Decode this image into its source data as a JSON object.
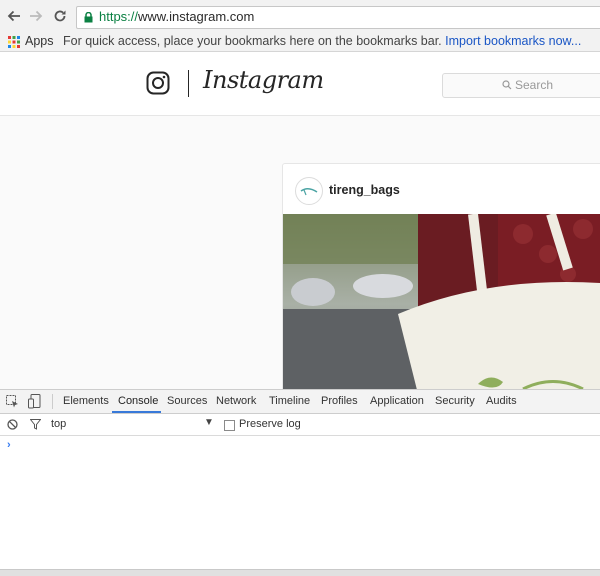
{
  "browser": {
    "url_scheme": "https://",
    "url_host": "www.instagram.com",
    "bookmarks_bar": {
      "apps_label": "Apps",
      "hint": "For quick access, place your bookmarks here on the bookmarks bar.",
      "import_link": "Import bookmarks now..."
    }
  },
  "instagram": {
    "wordmark": "Instagram",
    "search_placeholder": "Search",
    "post": {
      "username": "tireng_bags"
    }
  },
  "devtools": {
    "tabs": [
      "Elements",
      "Console",
      "Sources",
      "Network",
      "Timeline",
      "Profiles",
      "Application",
      "Security",
      "Audits"
    ],
    "active_tab": "Console",
    "context": "top",
    "preserve_log_label": "Preserve log",
    "preserve_log_checked": false,
    "prompt": "›"
  },
  "colors": {
    "link": "#1a56c5",
    "secure": "#0b8043",
    "devtools_accent": "#3879d9"
  }
}
